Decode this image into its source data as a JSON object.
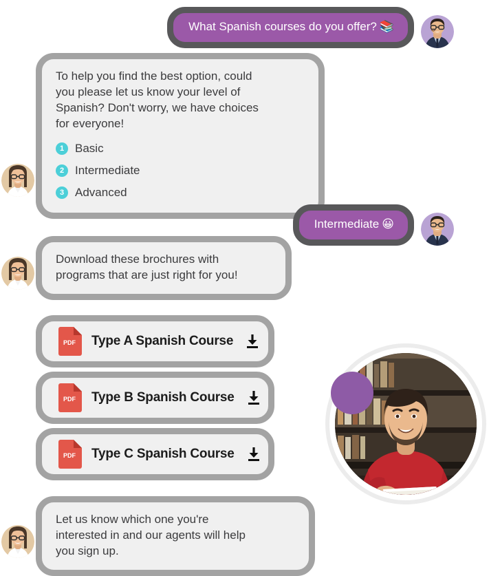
{
  "conversation": {
    "messages": [
      {
        "id": "msg-user-1",
        "sender": "user",
        "text": "What Spanish courses do you offer?",
        "emoji": "📚",
        "emoji_name": "books-emoji"
      },
      {
        "id": "msg-bot-1",
        "sender": "bot",
        "lines": [
          "To help you find the best option, could",
          "you please let us know your level of",
          "Spanish? Don't worry, we have choices",
          "for everyone!"
        ],
        "options": [
          {
            "number": "1",
            "label": "Basic"
          },
          {
            "number": "2",
            "label": "Intermediate"
          },
          {
            "number": "3",
            "label": "Advanced"
          }
        ]
      },
      {
        "id": "msg-user-2",
        "sender": "user",
        "text": "Intermediate",
        "emoji": "😀",
        "emoji_name": "grinning-face-emoji"
      },
      {
        "id": "msg-bot-2",
        "sender": "bot",
        "lines": [
          "Download these brochures with",
          "programs that are just right for you!"
        ]
      },
      {
        "id": "msg-bot-3",
        "sender": "bot",
        "lines": [
          "Let us know which one you're",
          "interested in and our agents will help",
          "you sign up."
        ]
      }
    ]
  },
  "downloads": {
    "file_type_label": "PDF",
    "items": [
      {
        "id": "pdf-card-a",
        "label": "Type A Spanish Course"
      },
      {
        "id": "pdf-card-b",
        "label": "Type B Spanish Course"
      },
      {
        "id": "pdf-card-c",
        "label": "Type C Spanish Course"
      }
    ]
  },
  "colors": {
    "user_bubble": "#9b59a8",
    "user_bubble_border": "#58585a",
    "bot_bubble": "#f0f0f0",
    "bot_bubble_border": "#a3a3a3",
    "badge": "#4ccfd8",
    "pdf_red": "#e3574a",
    "pdf_red_dark": "#b8382d",
    "accent_purple": "#8e5ba6",
    "text_dark": "#3b3b3d"
  }
}
